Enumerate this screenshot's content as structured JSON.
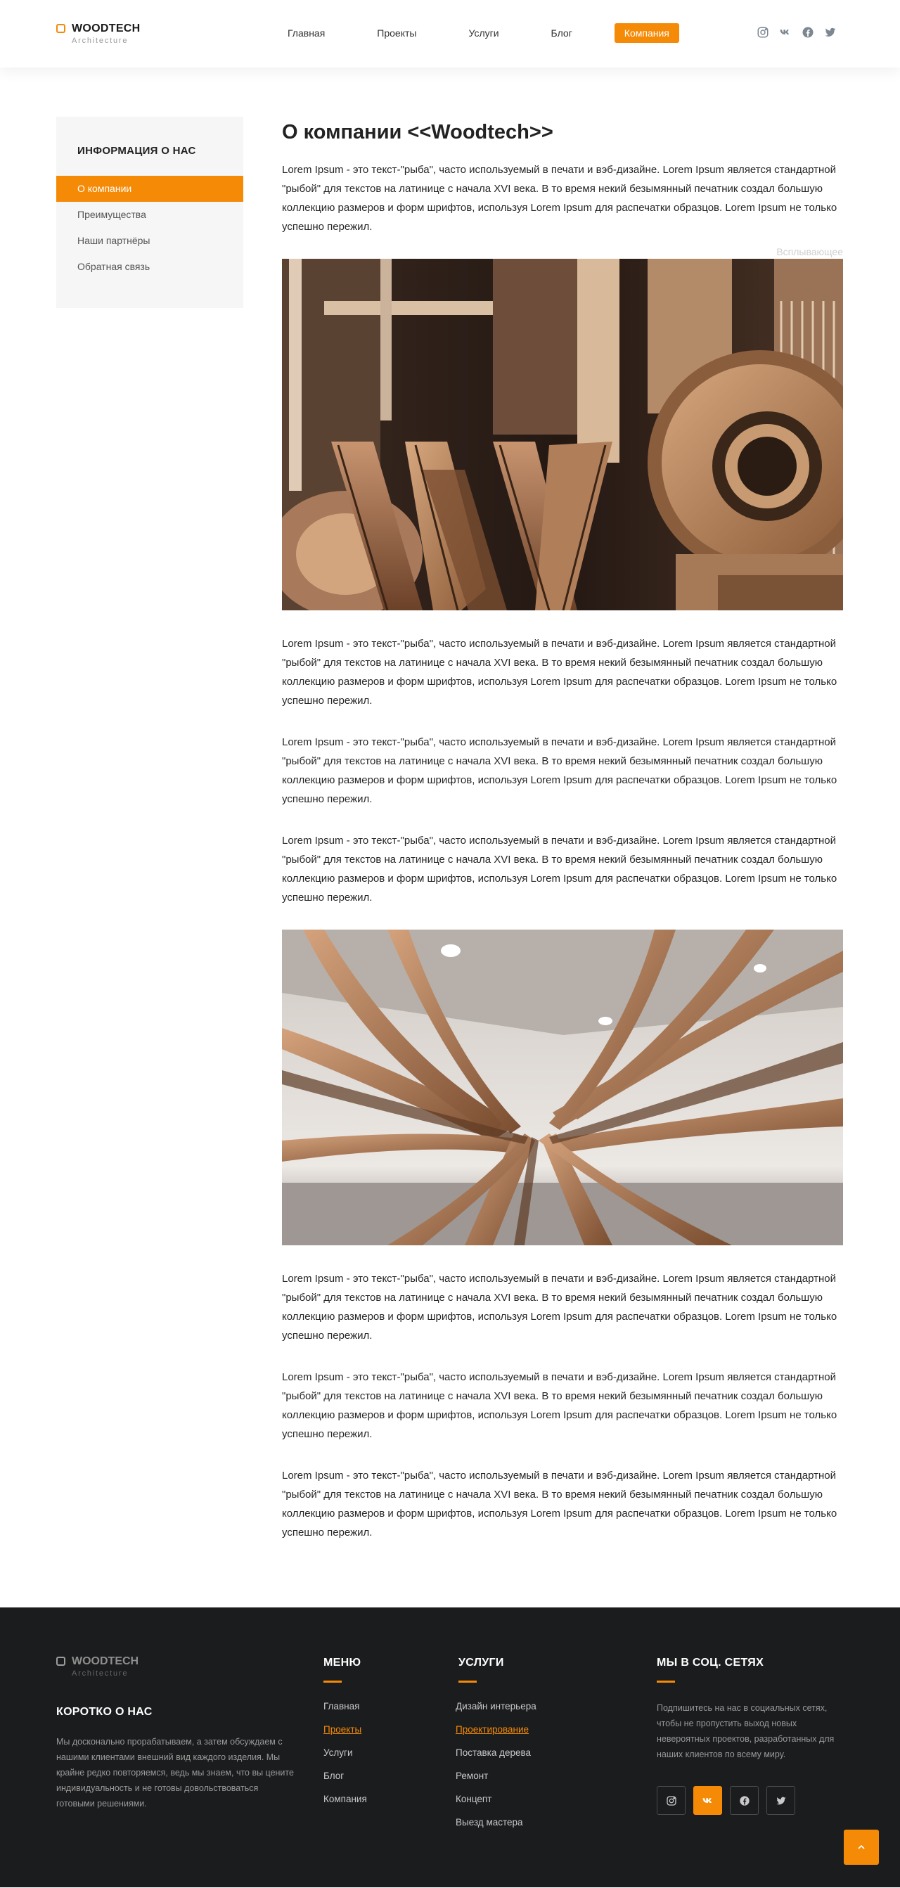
{
  "brand": {
    "name": "WOODTECH",
    "sub": "Architecture"
  },
  "nav": [
    "Главная",
    "Проекты",
    "Услуги",
    "Блог",
    "Компания"
  ],
  "nav_active": "Компания",
  "social_icons": [
    "instagram-icon",
    "vk-icon",
    "facebook-icon",
    "twitter-icon"
  ],
  "sidebar": {
    "title": "ИНФОРМАЦИЯ О НАС",
    "items": [
      "О компании",
      "Преимущества",
      "Наши партнёры",
      "Обратная связь"
    ],
    "active": "О компании"
  },
  "content": {
    "title": "О компании <<Woodtech>>",
    "tooltip": "Всплывающее",
    "paragraph": "Lorem Ipsum - это текст-\"рыба\", часто используемый в печати и вэб-дизайне. Lorem Ipsum является стандартной \"рыбой\" для текстов на латинице с начала XVI века. В то время некий безымянный печатник создал большую коллекцию размеров и форм шрифтов, используя Lorem Ipsum для распечатки образцов. Lorem Ipsum не только успешно пережил."
  },
  "footer": {
    "about_title": "КОРОТКО О НАС",
    "about_text": "Мы досконально прорабатываем, а затем обсуждаем с нашими клиентами внешний вид каждого изделия. Мы крайне редко повторяемся, ведь мы знаем, что вы цените индивидуальность и не готовы довольствоваться готовыми решениями.",
    "menu_title": "МЕНЮ",
    "menu": [
      "Главная",
      "Проекты",
      "Услуги",
      "Блог",
      "Компания"
    ],
    "menu_highlight": "Проекты",
    "services_title": "УСЛУГИ",
    "services": [
      "Дизайн интерьера",
      "Проектирование",
      "Поставка дерева",
      "Ремонт",
      "Концепт",
      "Выезд мастера"
    ],
    "services_highlight": "Проектирование",
    "social_title": "МЫ В СОЦ. СЕТЯХ",
    "social_text": "Подпишитесь на нас в социальных сетях, чтобы не пропустить выход новых невероятных проектов, разработанных для наших клиентов по всему миру.",
    "social_active": "vk-icon"
  },
  "colors": {
    "accent": "#f58a07",
    "footer_bg": "#1b1c1e",
    "sidebar_bg": "#f6f6f6"
  }
}
